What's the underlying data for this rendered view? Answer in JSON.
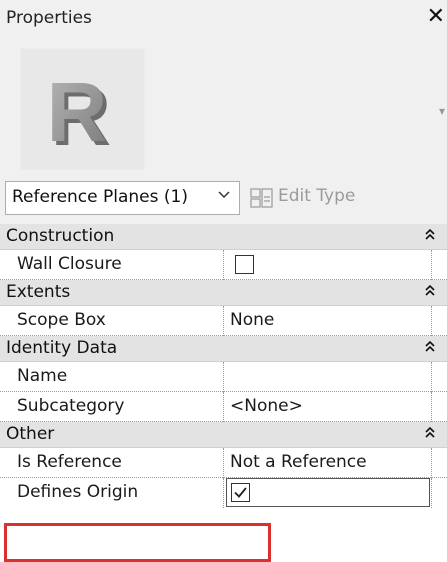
{
  "panel": {
    "title": "Properties",
    "close_glyph": "✕"
  },
  "preview": {
    "logo_letter": "R"
  },
  "type_selector": {
    "value": "Reference Planes (1)",
    "edit_type_label": "Edit Type"
  },
  "categories": [
    {
      "name": "Construction",
      "collapse_glyph": "⌃⌃"
    },
    {
      "name": "Extents"
    },
    {
      "name": "Identity Data"
    },
    {
      "name": "Other"
    }
  ],
  "params": {
    "wall_closure": {
      "name": "Wall Closure",
      "checked": false
    },
    "scope_box": {
      "name": "Scope Box",
      "value": "None"
    },
    "name": {
      "name": "Name",
      "value": ""
    },
    "subcategory": {
      "name": "Subcategory",
      "value": "<None>"
    },
    "is_reference": {
      "name": "Is Reference",
      "value": "Not a Reference"
    },
    "defines_origin": {
      "name": "Defines Origin",
      "checked": true
    }
  },
  "colors": {
    "highlight": "#d9312b",
    "category_bg": "#e3e3e3",
    "chrome_bg": "#f0f0f0"
  }
}
